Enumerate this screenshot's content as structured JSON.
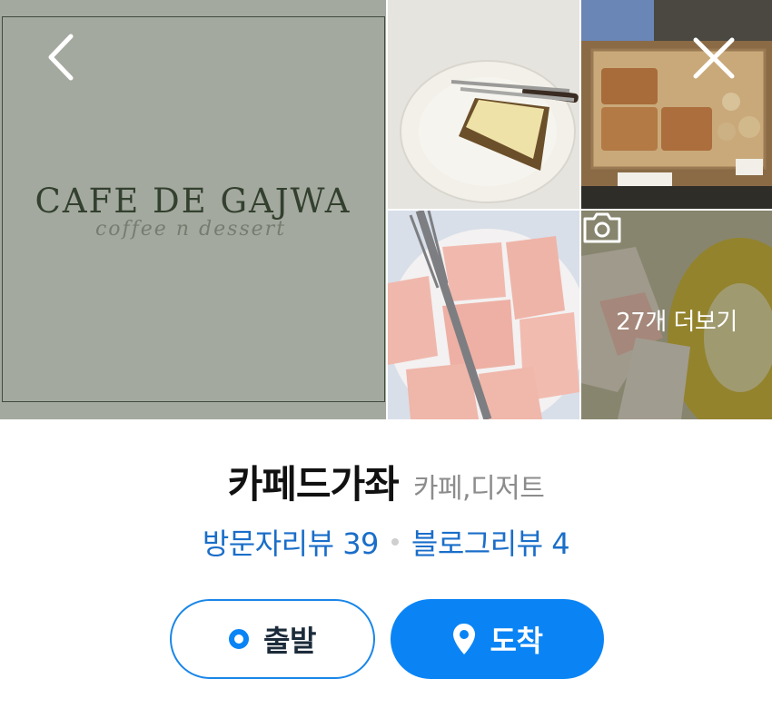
{
  "photos": {
    "logo_title": "CAFE DE GAJWA",
    "logo_subtitle": "coffee n dessert",
    "more_label": "27개 더보기"
  },
  "nav": {
    "back_icon": "chevron-left-icon",
    "close_icon": "close-icon"
  },
  "place": {
    "name": "카페드가좌",
    "category": "카페,디저트"
  },
  "reviews": {
    "visitor_label": "방문자리뷰 39",
    "blog_label": "블로그리뷰 4"
  },
  "actions": {
    "depart_label": "출발",
    "arrive_label": "도착"
  },
  "colors": {
    "accent": "#0a84f5",
    "link": "#1a6ec9",
    "title": "#111111",
    "muted": "#8c8c8c"
  }
}
